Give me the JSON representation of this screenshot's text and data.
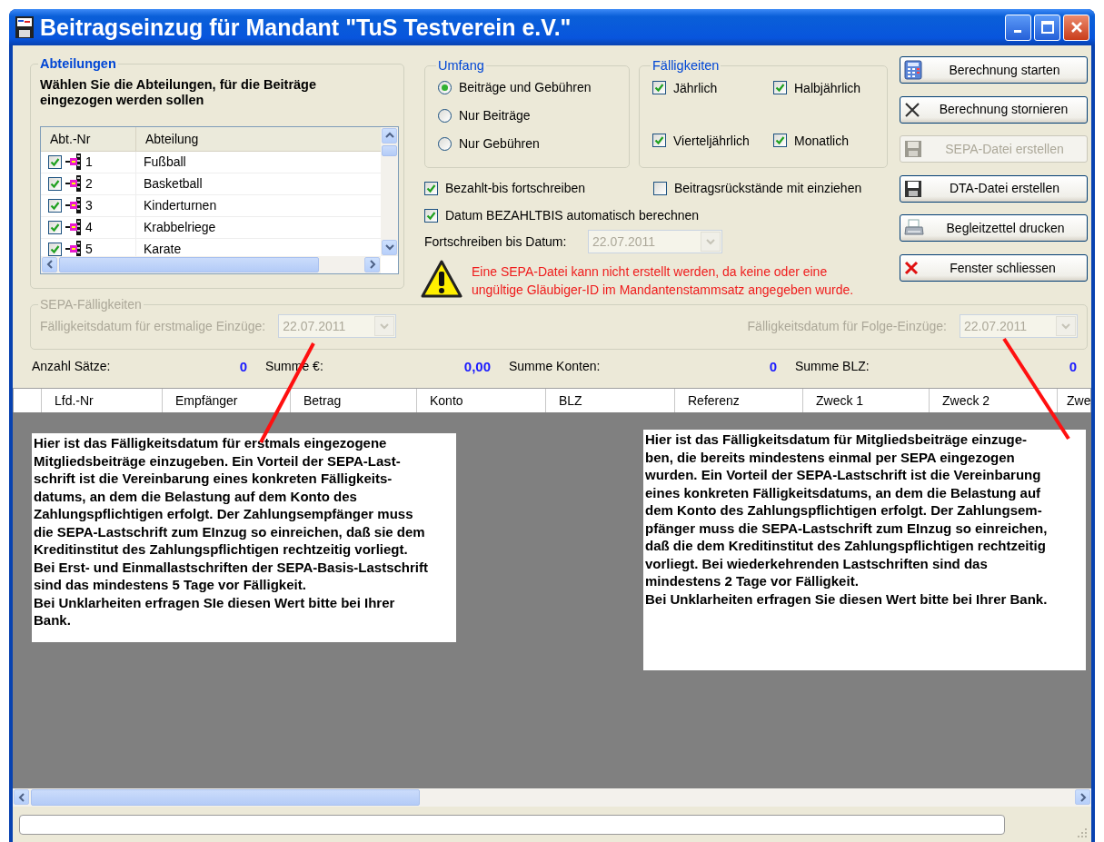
{
  "window": {
    "title": "Beitragseinzug für Mandant \"TuS Testverein e.V.\""
  },
  "departments": {
    "legend": "Abteilungen",
    "instruction": "Wählen Sie die Abteilungen, für die Beiträge eingezogen werden sollen",
    "columns": [
      "Abt.-Nr",
      "Abteilung"
    ],
    "rows": [
      {
        "number": "1",
        "name": "Fußball",
        "checked": true
      },
      {
        "number": "2",
        "name": "Basketball",
        "checked": true
      },
      {
        "number": "3",
        "name": "Kinderturnen",
        "checked": true
      },
      {
        "number": "4",
        "name": "Krabbelriege",
        "checked": true
      },
      {
        "number": "5",
        "name": "Karate",
        "checked": true
      }
    ]
  },
  "scope": {
    "legend": "Umfang",
    "options": [
      {
        "label": "Beiträge und Gebühren",
        "selected": true
      },
      {
        "label": "Nur Beiträge",
        "selected": false
      },
      {
        "label": "Nur Gebühren",
        "selected": false
      }
    ]
  },
  "due_intervals": {
    "legend": "Fälligkeiten",
    "options": [
      {
        "label": "Jährlich",
        "checked": true
      },
      {
        "label": "Halbjährlich",
        "checked": true
      },
      {
        "label": "Vierteljährlich",
        "checked": true
      },
      {
        "label": "Monatlich",
        "checked": true
      }
    ]
  },
  "options": [
    {
      "label": "Bezahlt-bis fortschreiben",
      "checked": true
    },
    {
      "label": "Beitragsrückstände mit einziehen",
      "checked": false
    },
    {
      "label": "Datum BEZAHLTBIS automatisch berechnen",
      "checked": true
    }
  ],
  "continue_until": {
    "label": "Fortschreiben bis Datum:",
    "value": "22.07.2011",
    "disabled": true
  },
  "warning": "Eine SEPA-Datei kann nicht erstellt werden, da keine oder eine ungültige Gläubiger-ID im Mandantenstammsatz angegeben wurde.",
  "buttons": [
    {
      "label": "Berechnung starten",
      "kind": "calculator",
      "disabled": false
    },
    {
      "label": "Berechnung stornieren",
      "kind": "cancel",
      "disabled": false
    },
    {
      "label": "SEPA-Datei erstellen",
      "kind": "disk",
      "disabled": true
    },
    {
      "label": "DTA-Datei erstellen",
      "kind": "disk",
      "disabled": false
    },
    {
      "label": "Begleitzettel drucken",
      "kind": "print",
      "disabled": false
    },
    {
      "label": "Fenster schliessen",
      "kind": "close",
      "disabled": false
    }
  ],
  "sepa_due": {
    "legend": "SEPA-Fälligkeiten",
    "disabled": true,
    "first": {
      "label": "Fälligkeitsdatum für erstmalige Einzüge:",
      "value": "22.07.2011"
    },
    "recurring": {
      "label": "Fälligkeitsdatum für Folge-Einzüge:",
      "value": "22.07.2011"
    }
  },
  "summary": [
    {
      "label": "Anzahl Sätze:",
      "value": "0"
    },
    {
      "label": "Summe €:",
      "value": "0,00"
    },
    {
      "label": "Summe Konten:",
      "value": "0"
    },
    {
      "label": "Summe BLZ:",
      "value": "0"
    }
  ],
  "table": {
    "columns": [
      "Lfd.-Nr",
      "Empfänger",
      "Betrag",
      "Konto",
      "BLZ",
      "Referenz",
      "Zweck 1",
      "Zweck 2",
      "Zwe"
    ]
  },
  "annotations": [
    {
      "text": "Hier ist das Fälligkeitsdatum für erstmals eingezogene\nMitgliedsbeiträge einzugeben. Ein Vorteil der SEPA-Last-\nschrift ist die Vereinbarung eines konkreten Fälligkeits-\ndatums, an dem die Belastung auf dem Konto des\nZahlungspflichtigen erfolgt. Der Zahlungsempfänger muss\ndie SEPA-Lastschrift zum EInzug so einreichen, daß sie dem\nKreditinstitut des Zahlungspflichtigen rechtzeitig vorliegt.\nBei Erst- und Einmallastschriften der SEPA-Basis-Lastschrift\nsind das mindestens 5 Tage vor Fälligkeit.\nBei Unklarheiten erfragen SIe diesen Wert bitte bei Ihrer\nBank."
    },
    {
      "text": "Hier ist das Fälligkeitsdatum für Mitgliedsbeiträge einzuge-\nben, die bereits mindestens einmal per SEPA eingezogen\nwurden. Ein Vorteil der SEPA-Lastschrift ist die Vereinbarung\neines konkreten Fälligkeitsdatums, an dem die Belastung auf\ndem Konto des Zahlungspflichtigen erfolgt. Der Zahlungsem-\npfänger muss die SEPA-Lastschrift zum EInzug so einreichen,\ndaß die dem Kreditinstitut des Zahlungspflichtigen rechtzeitig\nvorliegt. Bei wiederkehrenden Lastschriften sind das\nmindestens 2 Tage vor Fälligkeit.\nBei Unklarheiten erfragen Sie diesen Wert bitte bei Ihrer Bank."
    }
  ]
}
